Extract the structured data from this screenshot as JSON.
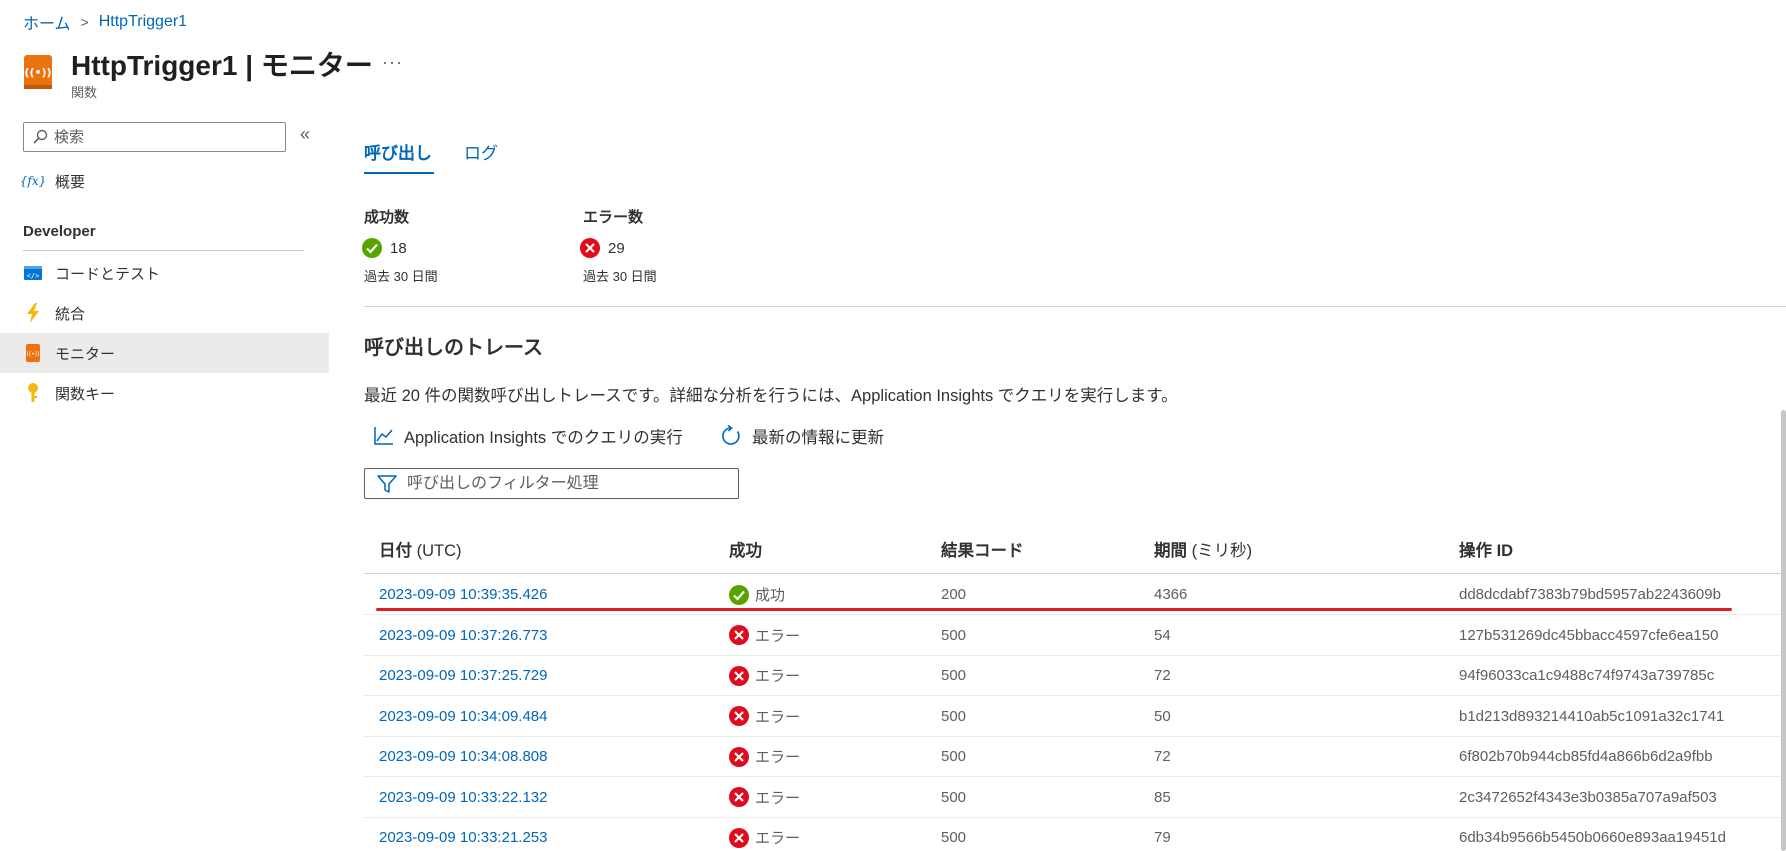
{
  "breadcrumb": {
    "home": "ホーム",
    "current": "HttpTrigger1"
  },
  "header": {
    "title_name": "HttpTrigger1",
    "title_sep": " | ",
    "title_page": "モニター",
    "more": "···",
    "subtitle": "関数"
  },
  "sidebar": {
    "search_placeholder": "検索",
    "collapse": "«",
    "overview": "概要",
    "section_label": "Developer",
    "items": [
      {
        "label": "コードとテスト",
        "icon": "code-icon"
      },
      {
        "label": "統合",
        "icon": "lightning-icon"
      },
      {
        "label": "モニター",
        "icon": "monitor-icon",
        "active": true
      },
      {
        "label": "関数キー",
        "icon": "key-icon"
      }
    ]
  },
  "tabs": {
    "invocations": "呼び出し",
    "logs": "ログ"
  },
  "stats": {
    "success": {
      "label": "成功数",
      "value": "18",
      "period": "過去 30 日間"
    },
    "error": {
      "label": "エラー数",
      "value": "29",
      "period": "過去 30 日間"
    }
  },
  "trace": {
    "title": "呼び出しのトレース",
    "description": "最近 20 件の関数呼び出しトレースです。詳細な分析を行うには、Application Insights でクエリを実行します。",
    "run_query": "Application Insights でのクエリの実行",
    "refresh": "最新の情報に更新",
    "filter_placeholder": "呼び出しのフィルター処理"
  },
  "table": {
    "headers": {
      "date": "日付",
      "date_unit": " (UTC)",
      "success": "成功",
      "result_code": "結果コード",
      "duration": "期間",
      "duration_unit": " (ミリ秒)",
      "operation_id": "操作 ID"
    },
    "rows": [
      {
        "date": "2023-09-09 10:39:35.426",
        "status": "成功",
        "ok": true,
        "code": "200",
        "duration": "4366",
        "op_id": "dd8dcdabf7383b79bd5957ab2243609b"
      },
      {
        "date": "2023-09-09 10:37:26.773",
        "status": "エラー",
        "ok": false,
        "code": "500",
        "duration": "54",
        "op_id": "127b531269dc45bbacc4597cfe6ea150"
      },
      {
        "date": "2023-09-09 10:37:25.729",
        "status": "エラー",
        "ok": false,
        "code": "500",
        "duration": "72",
        "op_id": "94f96033ca1c9488c74f9743a739785c"
      },
      {
        "date": "2023-09-09 10:34:09.484",
        "status": "エラー",
        "ok": false,
        "code": "500",
        "duration": "50",
        "op_id": "b1d213d893214410ab5c1091a32c1741"
      },
      {
        "date": "2023-09-09 10:34:08.808",
        "status": "エラー",
        "ok": false,
        "code": "500",
        "duration": "72",
        "op_id": "6f802b70b944cb85fd4a866b6d2a9fbb"
      },
      {
        "date": "2023-09-09 10:33:22.132",
        "status": "エラー",
        "ok": false,
        "code": "500",
        "duration": "85",
        "op_id": "2c3472652f4343e3b0385a707a9af503"
      },
      {
        "date": "2023-09-09 10:33:21.253",
        "status": "エラー",
        "ok": false,
        "code": "500",
        "duration": "79",
        "op_id": "6db34b9566b5450b0660e893aa19451d"
      }
    ]
  },
  "colors": {
    "accent": "#0067b8",
    "success": "#57a300",
    "error": "#e00b1c",
    "highlight": "#e01b24",
    "monitor_icon": "#e8730f"
  }
}
